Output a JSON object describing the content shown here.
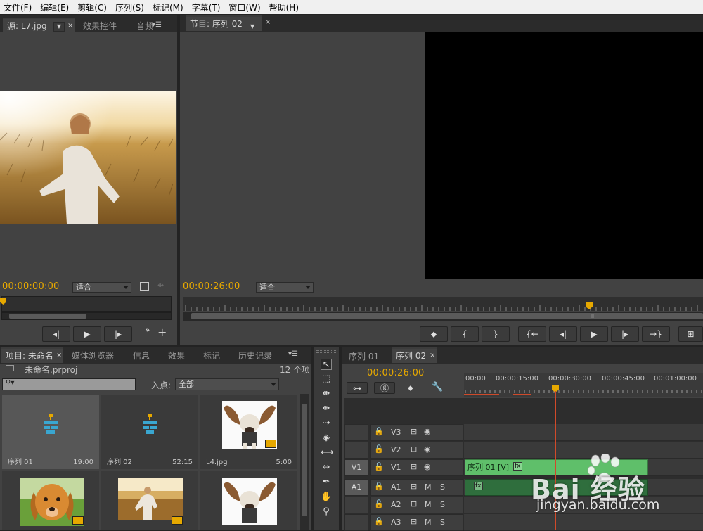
{
  "menu": [
    "文件(F)",
    "编辑(E)",
    "剪辑(C)",
    "序列(S)",
    "标记(M)",
    "字幕(T)",
    "窗口(W)",
    "帮助(H)"
  ],
  "source_panel": {
    "tab_source": "源: L7.jpg",
    "tab_effects": "效果控件",
    "tab_audio": "音频",
    "timecode": "00:00:00:00",
    "fit_label": "适合"
  },
  "program_panel": {
    "tab": "节目: 序列 02",
    "timecode": "00:00:26:00",
    "fit_label": "适合"
  },
  "project_panel": {
    "tabs": [
      "项目: 未命名",
      "媒体浏览器",
      "信息",
      "效果",
      "标记",
      "历史记录"
    ],
    "file_name": "未命名.prproj",
    "count": "12 个项",
    "inpoint_label": "入点:",
    "inpoint_value": "全部",
    "items": [
      {
        "name": "序列 01",
        "duration": "19:00",
        "kind": "sequence"
      },
      {
        "name": "序列 02",
        "duration": "52:15",
        "kind": "sequence"
      },
      {
        "name": "L4.jpg",
        "duration": "5:00",
        "kind": "image-dog-ears"
      },
      {
        "name": "",
        "duration": "",
        "kind": "image-golden-dog"
      },
      {
        "name": "",
        "duration": "",
        "kind": "image-field-girl"
      },
      {
        "name": "",
        "duration": "",
        "kind": "image-dog-ears"
      }
    ]
  },
  "timeline": {
    "tabs": [
      "序列 01",
      "序列 02"
    ],
    "timecode": "00:00:26:00",
    "ruler_labels": [
      "00:00",
      "00:00:15:00",
      "00:00:30:00",
      "00:00:45:00",
      "00:01:00:00"
    ],
    "video_tracks": [
      {
        "target": "",
        "name": "V3"
      },
      {
        "target": "",
        "name": "V2"
      },
      {
        "target": "V1",
        "name": "V1"
      }
    ],
    "audio_tracks": [
      {
        "target": "A1",
        "name": "A1",
        "m": "M",
        "s": "S"
      },
      {
        "target": "",
        "name": "A2",
        "m": "M",
        "s": "S"
      },
      {
        "target": "",
        "name": "A3",
        "m": "M",
        "s": "S"
      }
    ],
    "clip_v1_label": "序列 01 [V]",
    "fx": "fx"
  },
  "watermark": {
    "text": "Bai 经验",
    "url": "jingyan.baidu.com"
  },
  "colors": {
    "timecode": "#e6a800",
    "video_clip": "#5fbf6a",
    "audio_clip": "#2f6e3d",
    "playhead": "#d04a2a"
  }
}
